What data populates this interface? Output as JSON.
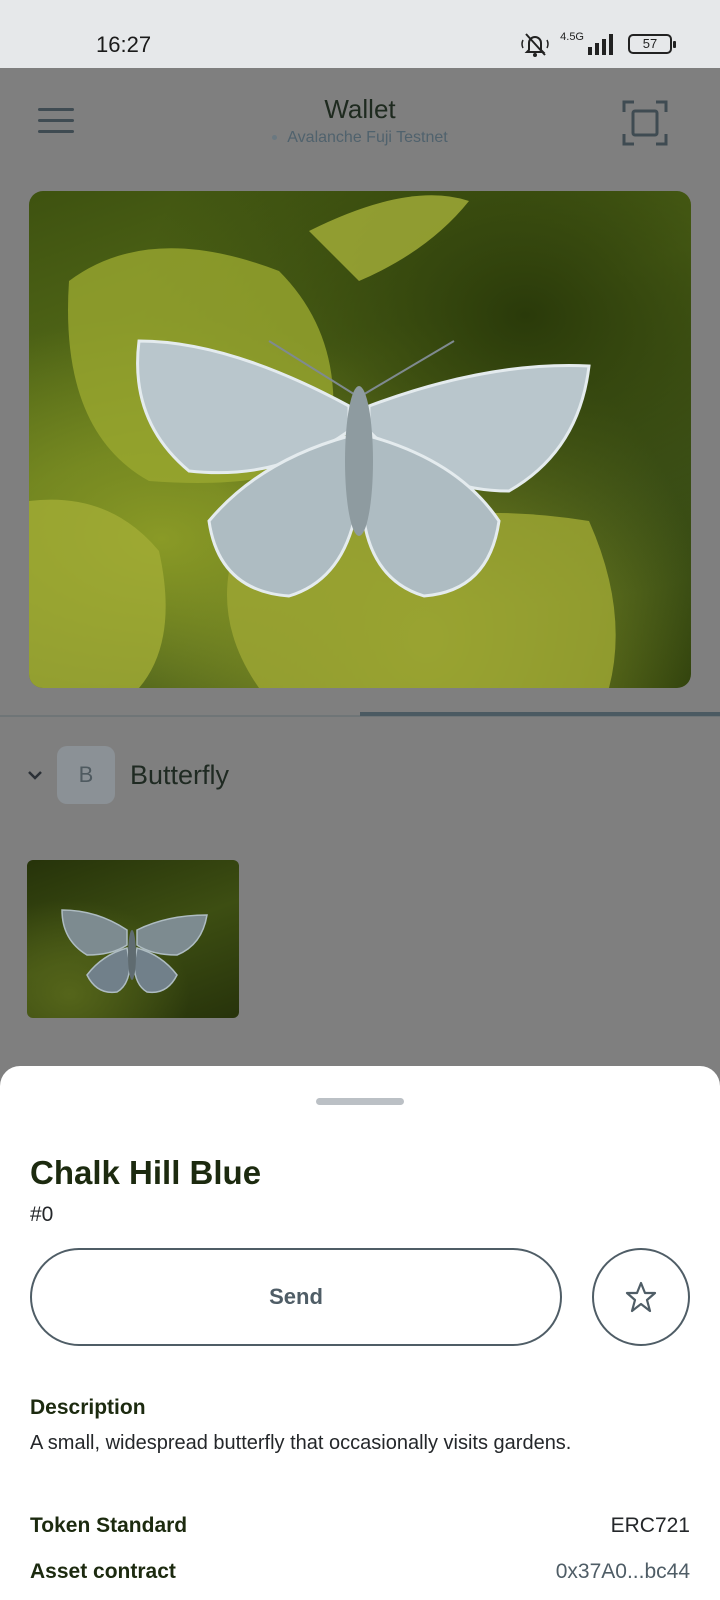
{
  "status_bar": {
    "time": "16:27",
    "network_type": "4.5G",
    "battery": "57"
  },
  "header": {
    "title": "Wallet",
    "network": "Avalanche Fuji Testnet",
    "icons": [
      "menu-icon",
      "scan-icon"
    ]
  },
  "collection": {
    "avatar_letter": "B",
    "name": "Butterfly"
  },
  "nft": {
    "name": "Chalk Hill Blue",
    "token_id": "#0",
    "send_label": "Send",
    "description_heading": "Description",
    "description": "A small, widespread butterfly that occasionally visits gardens.",
    "token_standard_label": "Token Standard",
    "token_standard": "ERC721",
    "asset_contract_label": "Asset contract",
    "asset_contract": "0x37A0...bc44"
  },
  "colors": {
    "overlay": "#7f7f7f",
    "sheet_bg": "#ffffff",
    "heading_text": "#1c2a0f",
    "button_outline": "#4f5d66",
    "link_text": "#4f5d66"
  }
}
